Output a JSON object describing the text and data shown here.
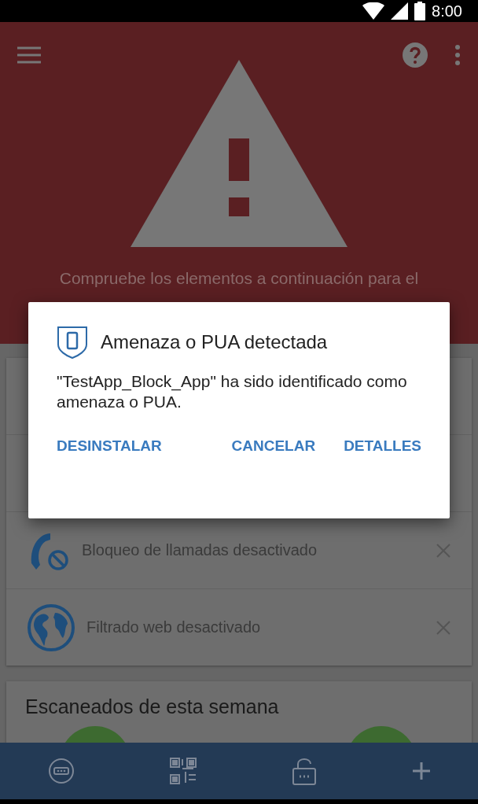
{
  "status_bar": {
    "time": "8:00"
  },
  "header": {
    "subtitle": "Compruebe los elementos a continuación para el"
  },
  "dialog": {
    "title": "Amenaza o PUA detectada",
    "message": "\"TestApp_Block_App\" ha sido identificado como amenaza o PUA.",
    "buttons": [
      "DESINSTALAR",
      "CANCELAR",
      "DETALLES"
    ]
  },
  "alerts": [
    {
      "kind": "call",
      "text": "Bloqueo de llamadas desactivado"
    },
    {
      "kind": "web",
      "text": "Filtrado web desactivado"
    }
  ],
  "scans_card": {
    "title": "Escaneados de esta semana"
  }
}
